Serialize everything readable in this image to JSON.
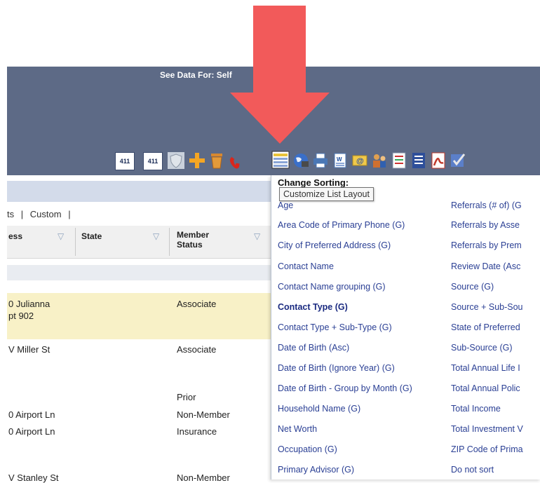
{
  "header": {
    "see_data_for": "See Data For: Self"
  },
  "toolbar": {
    "icon_411_a": "411",
    "icon_411_b": "411",
    "icons": [
      "411-icon",
      "411-icon",
      "shield-icon",
      "plus-icon",
      "trash-icon",
      "phone-icon",
      "list-layout-icon",
      "globe-icon",
      "printer-icon",
      "word-export-icon",
      "email-icon",
      "people-icon",
      "checklist-icon",
      "document-icon",
      "pdf-icon",
      "task-check-icon"
    ]
  },
  "view_links": {
    "item1": "ts",
    "sep1": "|",
    "custom": "Custom",
    "sep2": "|"
  },
  "table": {
    "headers": {
      "address": "ess",
      "state": "State",
      "member_status_line1": "Member",
      "member_status_line2": "Status"
    },
    "rows": [
      {
        "address_line1": "0 Julianna",
        "address_line2": "pt 902",
        "status": "Associate"
      },
      {
        "address_line1": "V Miller St",
        "address_line2": "",
        "status": "Associate"
      },
      {
        "address_line1": "",
        "address_line2": "",
        "status": "Prior"
      },
      {
        "address_line1": "0 Airport Ln",
        "address_line2": "",
        "status": "Non-Member"
      },
      {
        "address_line1": "0 Airport Ln",
        "address_line2": "",
        "status": "Insurance"
      },
      {
        "address_line1": "V Stanley St",
        "address_line2": "",
        "status": "Non-Member"
      }
    ]
  },
  "sort_menu": {
    "title": "Change Sorting:",
    "tooltip": "Customize List Layout",
    "col1": [
      "Age",
      "Area Code of Primary Phone (G)",
      "City of Preferred Address (G)",
      "Contact Name",
      "Contact Name grouping (G)",
      "Contact Type (G)",
      "Contact Type + Sub-Type (G)",
      "Date of Birth (Asc)",
      "Date of Birth (Ignore Year) (G)",
      "Date of Birth - Group by Month (G)",
      "Household Name (G)",
      "Net Worth",
      "Occupation (G)",
      "Primary Advisor (G)"
    ],
    "col2": [
      "Referrals (# of) (G",
      "Referrals by Asse",
      "Referrals by Prem",
      "Review Date (Asc",
      "Source (G)",
      "Source + Sub-Sou",
      "State of Preferred",
      "Sub-Source (G)",
      "Total Annual Life I",
      "Total Annual Polic",
      "Total Income",
      "Total Investment V",
      "ZIP Code of Prima",
      "Do not sort"
    ],
    "selected": "Contact Type (G)"
  },
  "colors": {
    "header_bg": "#5d6a86",
    "arrow": "#f25a5a",
    "link": "#2a3f94",
    "highlight_row": "#f8f1c7"
  }
}
